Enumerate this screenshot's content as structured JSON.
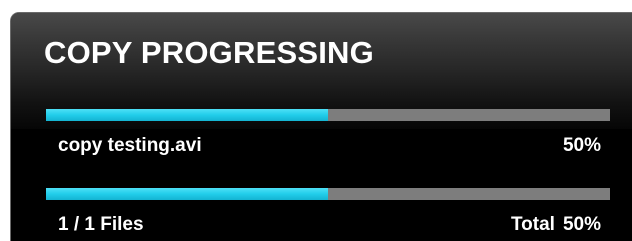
{
  "dialog": {
    "title": "COPY PROGRESSING"
  },
  "file_progress": {
    "filename": "copy testing.avi",
    "percent_label": "50%",
    "fraction": 0.5,
    "fill_color": "#21cdea",
    "track_color": "#7d7d7d"
  },
  "total_progress": {
    "files_label": "1 / 1 Files",
    "total_label": "Total",
    "percent_label": "50%",
    "fraction": 0.5
  }
}
